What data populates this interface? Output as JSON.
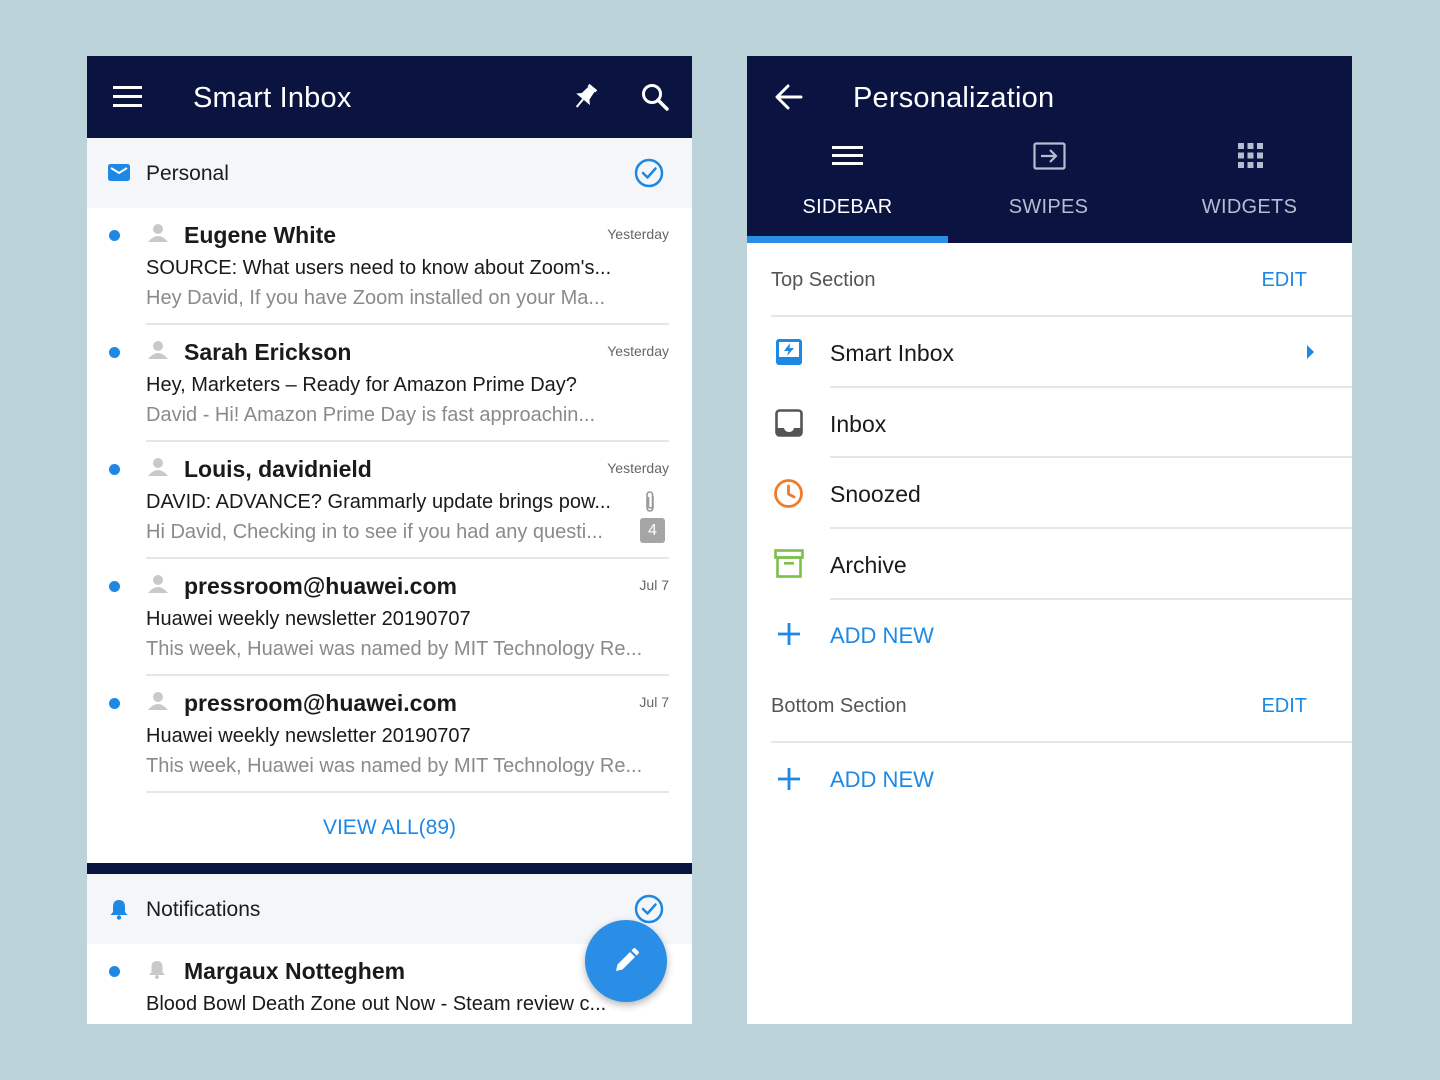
{
  "left": {
    "title": "Smart Inbox",
    "personal_section": "Personal",
    "emails": [
      {
        "sender": "Eugene White",
        "date": "Yesterday",
        "subject": "SOURCE: What users need to know about Zoom's...",
        "preview": "Hey David, If you have Zoom installed on your Ma..."
      },
      {
        "sender": "Sarah Erickson",
        "date": "Yesterday",
        "subject": "Hey, Marketers – Ready for Amazon Prime Day?",
        "preview": "David - Hi! Amazon Prime Day is fast approachin..."
      },
      {
        "sender": "Louis, davidnield",
        "date": "Yesterday",
        "subject": "DAVID: ADVANCE? Grammarly update brings pow...",
        "preview": "Hi David, Checking in to see if you had any questi...",
        "count": "4"
      },
      {
        "sender": "pressroom@huawei.com",
        "date": "Jul 7",
        "subject": "Huawei weekly newsletter 20190707",
        "preview": "This week, Huawei was named by MIT Technology Re..."
      },
      {
        "sender": "pressroom@huawei.com",
        "date": "Jul 7",
        "subject": "Huawei weekly newsletter 20190707",
        "preview": "This week, Huawei was named by MIT Technology Re..."
      }
    ],
    "view_all": "VIEW ALL(89)",
    "notifications_section": "Notifications",
    "notification": {
      "sender": "Margaux Notteghem",
      "subject": "Blood Bowl Death Zone out Now - Steam review c..."
    }
  },
  "right": {
    "title": "Personalization",
    "tabs": [
      {
        "label": "SIDEBAR",
        "icon": "menu-icon",
        "selected": true
      },
      {
        "label": "SWIPES",
        "icon": "swipe-icon",
        "selected": false
      },
      {
        "label": "WIDGETS",
        "icon": "grid-icon",
        "selected": false
      }
    ],
    "top_section": {
      "title": "Top Section",
      "edit": "EDIT"
    },
    "items": [
      {
        "label": "Smart Inbox",
        "icon": "smart-inbox-icon",
        "color": "#1e88e5"
      },
      {
        "label": "Inbox",
        "icon": "inbox-icon",
        "color": "#555555"
      },
      {
        "label": "Snoozed",
        "icon": "clock-icon",
        "color": "#f07c2a"
      },
      {
        "label": "Archive",
        "icon": "archive-icon",
        "color": "#7cc04a"
      }
    ],
    "add_new": "ADD NEW",
    "bottom_section": {
      "title": "Bottom Section",
      "edit": "EDIT"
    },
    "add_new_bottom": "ADD NEW"
  },
  "colors": {
    "navy": "#0b1441",
    "accent": "#1e88e5",
    "background": "#bcd3da"
  }
}
